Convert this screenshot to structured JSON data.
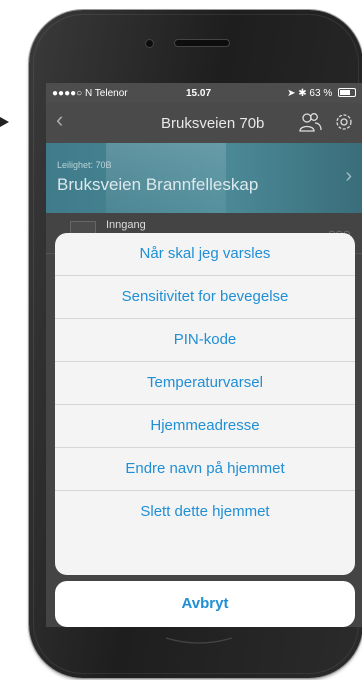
{
  "status_bar": {
    "carrier": "●●●●○ N Telenor",
    "time": "15.07",
    "battery": "63 %"
  },
  "nav": {
    "back_icon": "chevron-left-icon",
    "title": "Bruksveien 70b",
    "users_icon": "users-icon",
    "settings_icon": "gear-icon"
  },
  "hero": {
    "subtitle": "Leilighet: 70B",
    "title": "Bruksveien Brannfelleskap"
  },
  "list": {
    "items": [
      {
        "label": "Inngang",
        "dots": "○○○"
      }
    ]
  },
  "action_sheet": {
    "items": [
      "Når skal jeg varsles",
      "Sensitivitet for bevegelse",
      "PIN-kode",
      "Temperaturvarsel",
      "Hjemmeadresse",
      "Endre navn på hjemmet",
      "Slett dette hjemmet"
    ],
    "cancel": "Avbryt"
  },
  "colors": {
    "accent": "#1f8fd6",
    "hero": "#4c8a98",
    "sheet": "#f4f4f4"
  }
}
